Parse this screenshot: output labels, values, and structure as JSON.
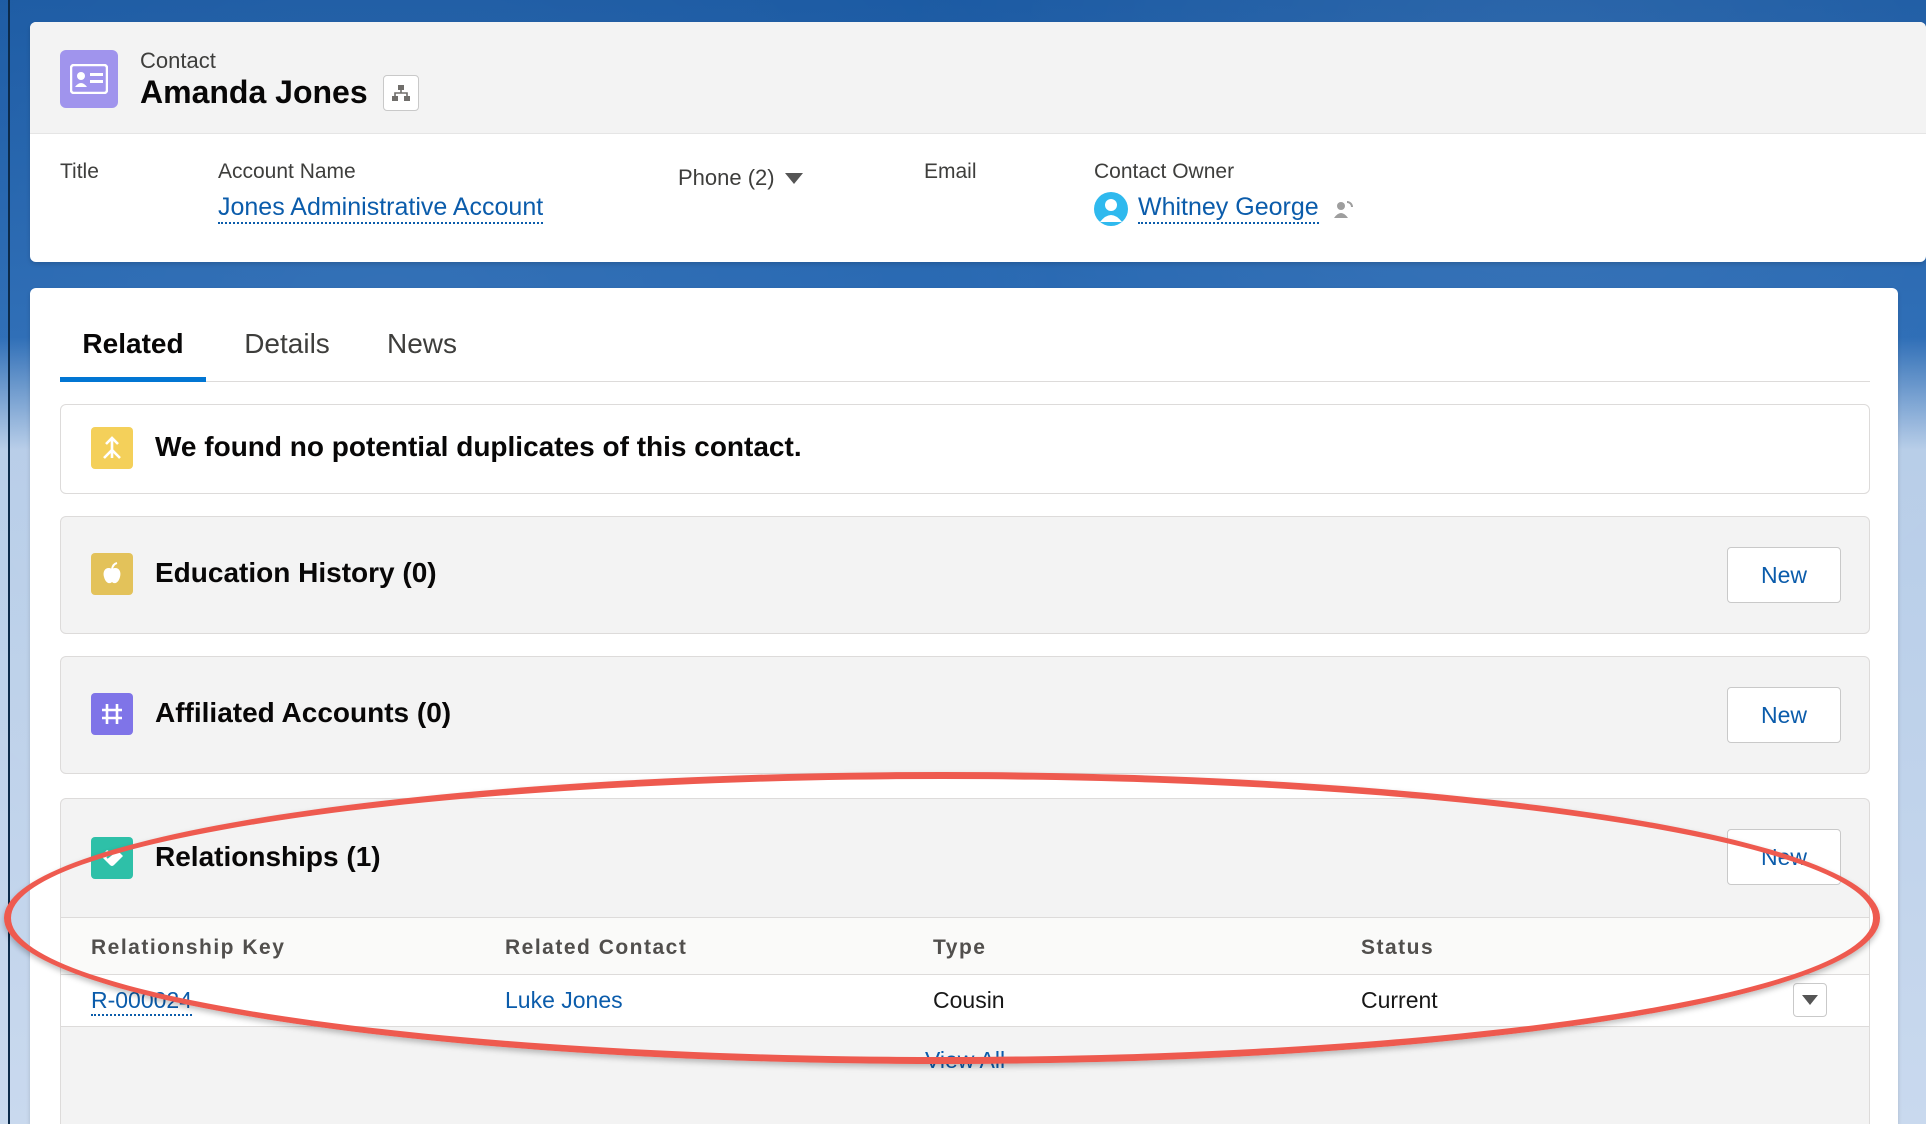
{
  "header": {
    "entity_label": "Contact",
    "record_name": "Amanda Jones",
    "fields": {
      "title_label": "Title",
      "account_label": "Account Name",
      "account_value": "Jones Administrative Account",
      "phone_label": "Phone (2)",
      "email_label": "Email",
      "owner_label": "Contact Owner",
      "owner_value": "Whitney George"
    }
  },
  "tabs": [
    {
      "label": "Related",
      "active": true
    },
    {
      "label": "Details",
      "active": false
    },
    {
      "label": "News",
      "active": false
    }
  ],
  "duplicates": {
    "message": "We found no potential duplicates of this contact."
  },
  "related_lists": {
    "education": {
      "title": "Education History (0)",
      "new_label": "New"
    },
    "affiliated": {
      "title": "Affiliated Accounts (0)",
      "new_label": "New"
    },
    "relationships": {
      "title": "Relationships (1)",
      "new_label": "New",
      "columns": [
        "Relationship Key",
        "Related Contact",
        "Type",
        "Status"
      ],
      "rows": [
        {
          "key": "R-000024",
          "related_contact": "Luke Jones",
          "type": "Cousin",
          "status": "Current"
        }
      ],
      "view_all": "View All"
    }
  },
  "colors": {
    "contact_icon": "#a094ed",
    "duplicate_icon": "#f4d05a",
    "education_icon": "#e3c25a",
    "affiliated_icon": "#7f74e8",
    "relationships_icon": "#2ec0a8",
    "link": "#0b5cab",
    "highlight": "#ee5a4f"
  }
}
